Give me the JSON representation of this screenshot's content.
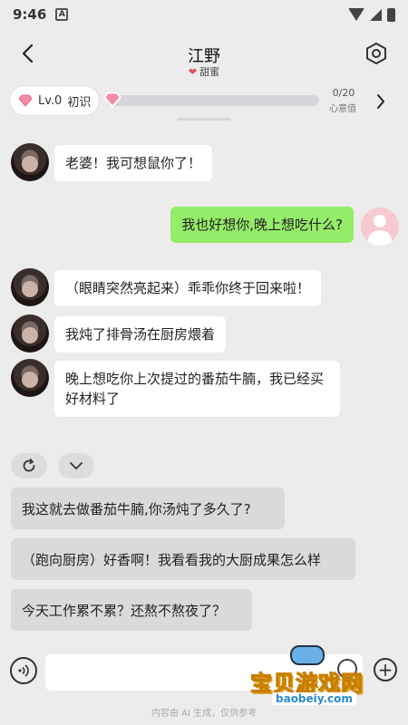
{
  "status_bar": {
    "time": "9:46",
    "notif_label": "A"
  },
  "header": {
    "title": "江野",
    "subtitle": "甜蜜",
    "subtitle_icon": "heart-emoji-icon"
  },
  "level": {
    "label": "Lv.0",
    "rank": "初识",
    "progress_text": "0/20",
    "progress_fraction": 0.0,
    "progress_label": "心意值"
  },
  "messages": [
    {
      "from": "bot",
      "text": "老婆！我可想鼠你了！"
    },
    {
      "from": "me",
      "text": "我也好想你,晚上想吃什么?"
    },
    {
      "from": "bot",
      "text": "（眼睛突然亮起来）乖乖你终于回来啦！"
    },
    {
      "from": "bot",
      "text": "我炖了排骨汤在厨房煨着"
    },
    {
      "from": "bot",
      "text": "晚上想吃你上次提过的番茄牛腩，我已经买好材料了"
    }
  ],
  "suggestions": [
    "我这就去做番茄牛腩,你汤炖了多久了?",
    "（跑向厨房）好香啊！我看看我的大厨成果怎么样",
    "今天工作累不累？还熬不熬夜了？"
  ],
  "input": {
    "placeholder": ""
  },
  "disclaimer": "内容由 AI 生成，仅供参考",
  "watermark": {
    "text": "宝贝游戏网",
    "url": "baobeiy.com"
  },
  "colors": {
    "my_bubble": "#95ec69",
    "bot_bubble": "#ffffff",
    "accent_pink": "#f7a8b8"
  }
}
